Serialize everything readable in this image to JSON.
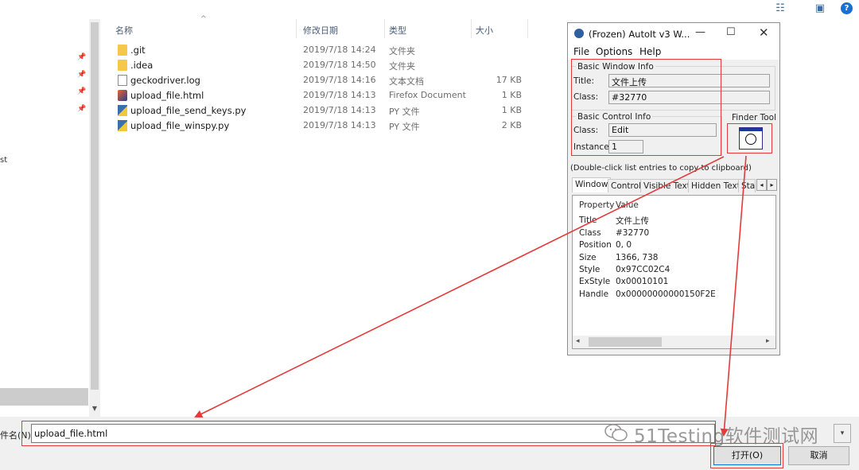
{
  "explorer": {
    "columns": {
      "name": "名称",
      "date": "修改日期",
      "type": "类型",
      "size": "大小"
    },
    "files": [
      {
        "name": ".git",
        "date": "2019/7/18 14:24",
        "type": "文件夹",
        "size": "",
        "icon": "folder-icon"
      },
      {
        "name": ".idea",
        "date": "2019/7/18 14:50",
        "type": "文件夹",
        "size": "",
        "icon": "folder-icon"
      },
      {
        "name": "geckodriver.log",
        "date": "2019/7/18 14:16",
        "type": "文本文档",
        "size": "17 KB",
        "icon": "text-file-icon"
      },
      {
        "name": "upload_file.html",
        "date": "2019/7/18 14:13",
        "type": "Firefox Document",
        "size": "1 KB",
        "icon": "firefox-document-icon"
      },
      {
        "name": "upload_file_send_keys.py",
        "date": "2019/7/18 14:13",
        "type": "PY 文件",
        "size": "1 KB",
        "icon": "python-file-icon"
      },
      {
        "name": "upload_file_winspy.py",
        "date": "2019/7/18 14:13",
        "type": "PY 文件",
        "size": "2 KB",
        "icon": "python-file-icon"
      }
    ],
    "nav_partial_text": "st",
    "filename_label": "件名(N):",
    "filename_value": "upload_file.html",
    "open_button": "打开(O)",
    "cancel_button": "取消"
  },
  "watermark": "51Testing软件测试网",
  "autoit": {
    "title": "(Frozen) AutoIt v3 W...",
    "menu": [
      "File",
      "Options",
      "Help"
    ],
    "basic_window_info": {
      "title": "Basic Window Info",
      "title_label": "Title:",
      "title_value": "文件上传",
      "class_label": "Class:",
      "class_value": "#32770"
    },
    "basic_control_info": {
      "title": "Basic Control Info",
      "class_label": "Class:",
      "class_value": "Edit",
      "instance_label": "Instance:",
      "instance_value": "1"
    },
    "finder_tool": "Finder Tool",
    "hint": "(Double-click list entries to copy to clipboard)",
    "tabs": [
      "Window",
      "Control",
      "Visible Text",
      "Hidden Text",
      "Stat"
    ],
    "property_header": "Property",
    "value_header": "Value",
    "properties": [
      {
        "k": "Title",
        "v": "文件上传"
      },
      {
        "k": "Class",
        "v": "#32770"
      },
      {
        "k": "Position",
        "v": "0, 0"
      },
      {
        "k": "Size",
        "v": "1366, 738"
      },
      {
        "k": "Style",
        "v": "0x97CC02C4"
      },
      {
        "k": "ExStyle",
        "v": "0x00010101"
      },
      {
        "k": "Handle",
        "v": "0x00000000000150F2E"
      }
    ]
  },
  "colors": {
    "annotation_red": "#e33b3b",
    "accent_blue": "#0078d7"
  }
}
